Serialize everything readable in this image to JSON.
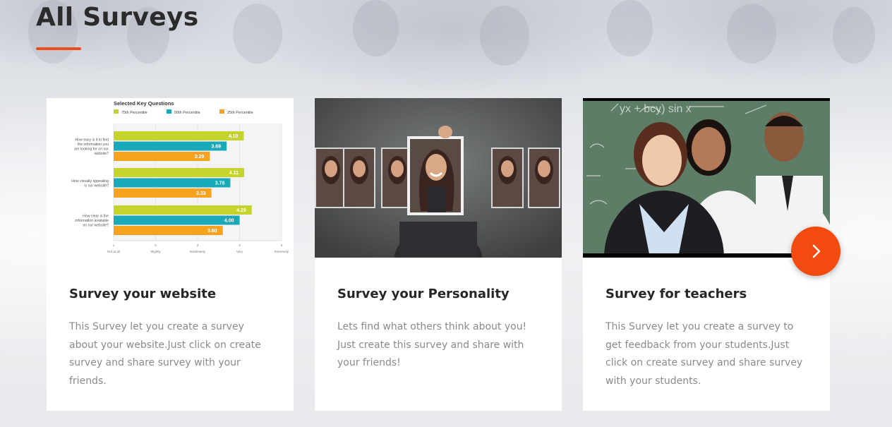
{
  "page": {
    "title": "All Surveys",
    "accent_color": "#ef4d1c"
  },
  "cards": [
    {
      "title": "Survey your website",
      "description": "This Survey let you create a survey about your website.Just click on create survey and share survey with your friends.",
      "image": "bar-chart-image",
      "chart_data": {
        "type": "bar",
        "title": "Selected Key Questions",
        "categories": [
          "How easy is it to find the information you are looking for on our website?",
          "How visually appealing is our website?",
          "How clear is the information available on our website?"
        ],
        "series": [
          {
            "name": "75th Percentile",
            "color": "#c5d42c",
            "values": [
              4.1,
              4.11,
              4.29
            ]
          },
          {
            "name": "50th Percentile",
            "color": "#1aa9b8",
            "values": [
              3.69,
              3.78,
              4.0
            ]
          },
          {
            "name": "25th Percentile",
            "color": "#f7a21e",
            "values": [
              3.29,
              3.33,
              3.6
            ]
          }
        ],
        "x_ticks": [
          "1",
          "2",
          "3",
          "4",
          "5"
        ],
        "x_tick_labels": [
          "Not at all",
          "Slightly",
          "Moderately",
          "Very",
          "Extremely"
        ],
        "xlim": [
          1,
          5
        ],
        "legend": "top",
        "orientation": "horizontal"
      }
    },
    {
      "title": "Survey your Personality",
      "description": "Lets find what others think about you! Just create this survey and share with your friends!",
      "image": "personality-photo"
    },
    {
      "title": "Survey for teachers",
      "description": "This Survey let you create a survey to get feedback from your students.Just click on create survey and share survey with your students.",
      "image": "teachers-photo"
    }
  ],
  "carousel": {
    "next_icon": "chevron-right-icon",
    "button_color": "#f24a0f"
  }
}
